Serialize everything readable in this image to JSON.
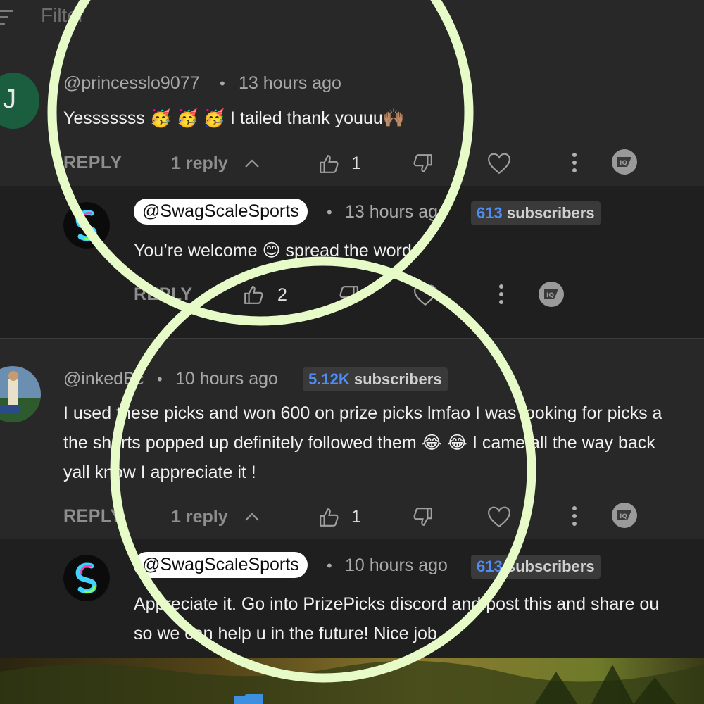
{
  "filter": {
    "label": "Filter"
  },
  "comments": [
    {
      "avatar_letter": "J",
      "handle": "@princesslo9077",
      "time": "13 hours ago",
      "text": "Yesssssss 🥳 🥳 🥳  I tailed thank youuu🙌🏽",
      "reply_label": "REPLY",
      "replies_count": "1 reply",
      "likes": "1"
    },
    {
      "handle": "@inkedBc",
      "time": "10 hours ago",
      "subscribers_number": "5.12K",
      "subscribers_label": "subscribers",
      "text_lines": [
        "I used these picks and won 600 on prize picks lmfao I was looking for picks a",
        "the shorts popped up definitely followed them 😂 😂 I came all the way back",
        "yall know I appreciate it !"
      ],
      "reply_label": "REPLY",
      "replies_count": "1 reply",
      "likes": "1"
    }
  ],
  "replies": [
    {
      "handle": "@SwagScaleSports",
      "time": "13 hours ago",
      "subscribers_number": "613",
      "subscribers_label": "subscribers",
      "text": "You’re welcome 😊 spread the word",
      "reply_label": "REPLY",
      "likes": "2"
    },
    {
      "handle": "@SwagScaleSports",
      "time": "10 hours ago",
      "subscribers_number": "613",
      "subscribers_label": "subscribers",
      "text_lines": [
        "Appreciate it.  Go into PrizePicks discord and post this and share ou",
        "so we can help u in the future!  Nice job"
      ]
    }
  ],
  "separator": "•",
  "colors": {
    "highlight_ring": "#e6fbc7",
    "subscriber_number": "#4f8df5",
    "avatar_green": "#1b5e3f"
  }
}
